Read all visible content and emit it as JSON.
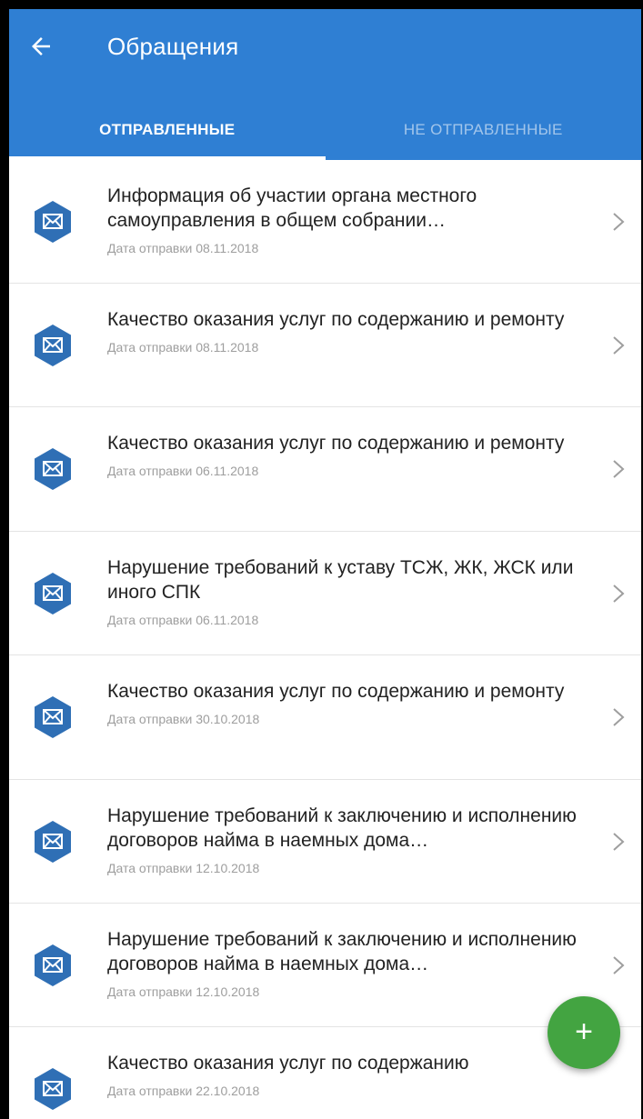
{
  "header": {
    "title": "Обращения",
    "background": "#2f7fd3"
  },
  "tabs": [
    {
      "label": "ОТПРАВЛЕННЫЕ",
      "active": true
    },
    {
      "label": "НЕ ОТПРАВЛЕННЫЕ",
      "active": false
    }
  ],
  "items": [
    {
      "title": "Информация об участии органа местного самоуправления в общем собрании…",
      "date": "Дата отправки 08.11.2018"
    },
    {
      "title": "Качество оказания услуг по содержанию и ремонту",
      "date": "Дата отправки 08.11.2018"
    },
    {
      "title": "Качество оказания услуг по содержанию и ремонту",
      "date": "Дата отправки 06.11.2018"
    },
    {
      "title": "Нарушение требований к уставу ТСЖ, ЖК, ЖСК или иного СПК",
      "date": "Дата отправки 06.11.2018"
    },
    {
      "title": "Качество оказания услуг по содержанию и ремонту",
      "date": "Дата отправки 30.10.2018"
    },
    {
      "title": "Нарушение требований к заключению и исполнению договоров найма в наемных дома…",
      "date": "Дата отправки 12.10.2018"
    },
    {
      "title": "Нарушение требований к заключению и исполнению договоров найма в наемных дома…",
      "date": "Дата отправки 12.10.2018"
    },
    {
      "title": "Качество оказания услуг по содержанию",
      "date": "Дата отправки 22.10.2018"
    }
  ],
  "fab": {
    "label": "+",
    "color": "#43a441"
  },
  "icons": {
    "back": "arrow-left-icon",
    "item": "envelope-icon",
    "chevron": "chevron-right-icon"
  }
}
